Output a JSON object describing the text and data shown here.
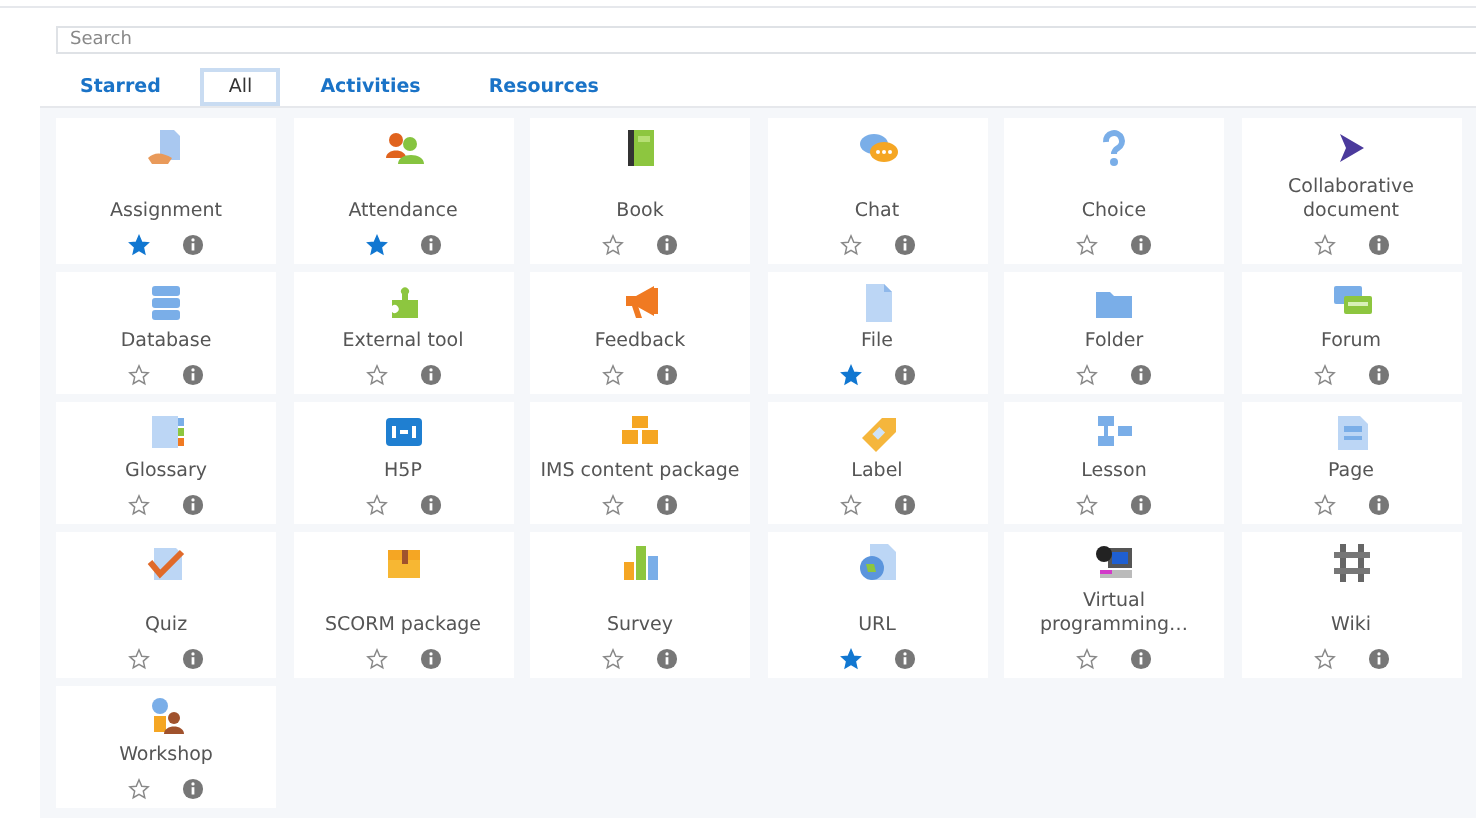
{
  "search": {
    "placeholder": "Search"
  },
  "tabs": [
    {
      "label": "Starred",
      "selected": false
    },
    {
      "label": "All",
      "selected": true
    },
    {
      "label": "Activities",
      "selected": false
    },
    {
      "label": "Resources",
      "selected": false
    }
  ],
  "modules": [
    {
      "kind": "assignment",
      "label": "Assignment",
      "starred": true
    },
    {
      "kind": "attendance",
      "label": "Attendance",
      "starred": true
    },
    {
      "kind": "book",
      "label": "Book",
      "starred": false
    },
    {
      "kind": "chat",
      "label": "Chat",
      "starred": false
    },
    {
      "kind": "choice",
      "label": "Choice",
      "starred": false
    },
    {
      "kind": "arrow",
      "label": "Collaborative document",
      "starred": false
    },
    {
      "kind": "database",
      "label": "Database",
      "starred": false
    },
    {
      "kind": "puzzle",
      "label": "External tool",
      "starred": false
    },
    {
      "kind": "megaphone",
      "label": "Feedback",
      "starred": false
    },
    {
      "kind": "file",
      "label": "File",
      "starred": true
    },
    {
      "kind": "folder",
      "label": "Folder",
      "starred": false
    },
    {
      "kind": "forum",
      "label": "Forum",
      "starred": false
    },
    {
      "kind": "glossary",
      "label": "Glossary",
      "starred": false
    },
    {
      "kind": "tile",
      "label": "H5P",
      "starred": false
    },
    {
      "kind": "boxes",
      "label": "IMS content package",
      "starred": false
    },
    {
      "kind": "tag",
      "label": "Label",
      "starred": false
    },
    {
      "kind": "lesson",
      "label": "Lesson",
      "starred": false
    },
    {
      "kind": "page",
      "label": "Page",
      "starred": false
    },
    {
      "kind": "quiz",
      "label": "Quiz",
      "starred": false
    },
    {
      "kind": "chest",
      "label": "SCORM package",
      "starred": false
    },
    {
      "kind": "bars",
      "label": "Survey",
      "starred": false
    },
    {
      "kind": "globe",
      "label": "URL",
      "starred": true
    },
    {
      "kind": "computer",
      "label": "Virtual programming…",
      "starred": false
    },
    {
      "kind": "grid",
      "label": "Wiki",
      "starred": false
    },
    {
      "kind": "people",
      "label": "Workshop",
      "starred": false
    }
  ]
}
